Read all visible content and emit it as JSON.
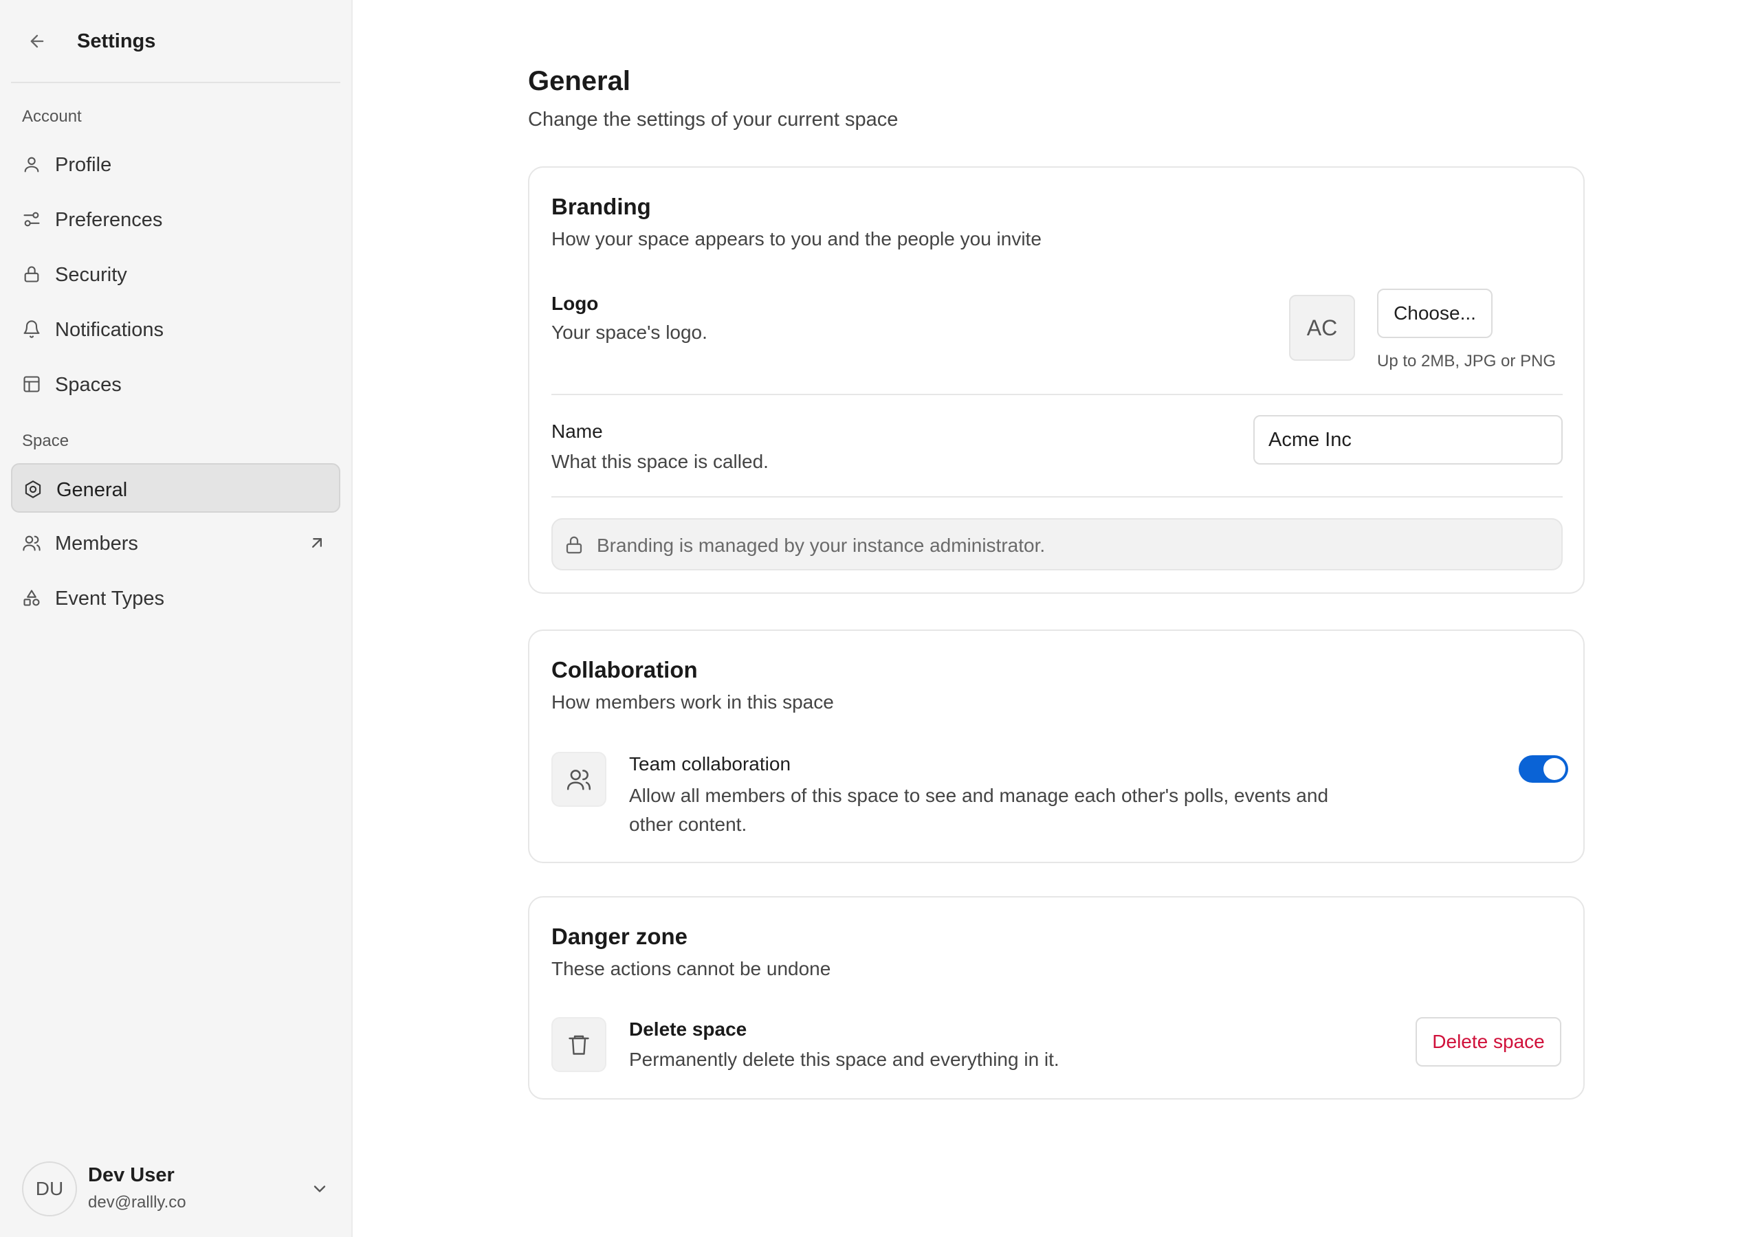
{
  "sidebar": {
    "title": "Settings",
    "sections": [
      {
        "label": "Account",
        "items": [
          {
            "label": "Profile",
            "icon": "user-icon"
          },
          {
            "label": "Preferences",
            "icon": "sliders-icon"
          },
          {
            "label": "Security",
            "icon": "lock-icon"
          },
          {
            "label": "Notifications",
            "icon": "bell-icon"
          },
          {
            "label": "Spaces",
            "icon": "layout-icon"
          }
        ]
      },
      {
        "label": "Space",
        "items": [
          {
            "label": "General",
            "icon": "settings-hex-icon",
            "active": true
          },
          {
            "label": "Members",
            "icon": "users-icon",
            "external": true
          },
          {
            "label": "Event Types",
            "icon": "shapes-icon"
          }
        ]
      }
    ],
    "user": {
      "initials": "DU",
      "name": "Dev User",
      "email": "dev@rallly.co"
    }
  },
  "page": {
    "title": "General",
    "subtitle": "Change the settings of your current space"
  },
  "branding": {
    "title": "Branding",
    "subtitle": "How your space appears to you and the people you invite",
    "logo": {
      "label": "Logo",
      "description": "Your space's logo.",
      "initials": "AC",
      "button": "Choose...",
      "hint": "Up to 2MB, JPG or PNG"
    },
    "name": {
      "label": "Name",
      "description": "What this space is called.",
      "value": "Acme Inc"
    },
    "notice": "Branding is managed by your instance administrator."
  },
  "collaboration": {
    "title": "Collaboration",
    "subtitle": "How members work in this space",
    "team": {
      "label": "Team collaboration",
      "description_line1": "Allow all members of this space to see and manage each other's polls, events and",
      "description_line2": "other content.",
      "enabled": true
    }
  },
  "danger": {
    "title": "Danger zone",
    "subtitle": "These actions cannot be undone",
    "delete": {
      "label": "Delete space",
      "description": "Permanently delete this space and everything in it.",
      "button": "Delete space"
    }
  },
  "colors": {
    "accent": "#0a63d6",
    "danger": "#d0103a",
    "sidebar_bg": "#f5f5f5"
  }
}
